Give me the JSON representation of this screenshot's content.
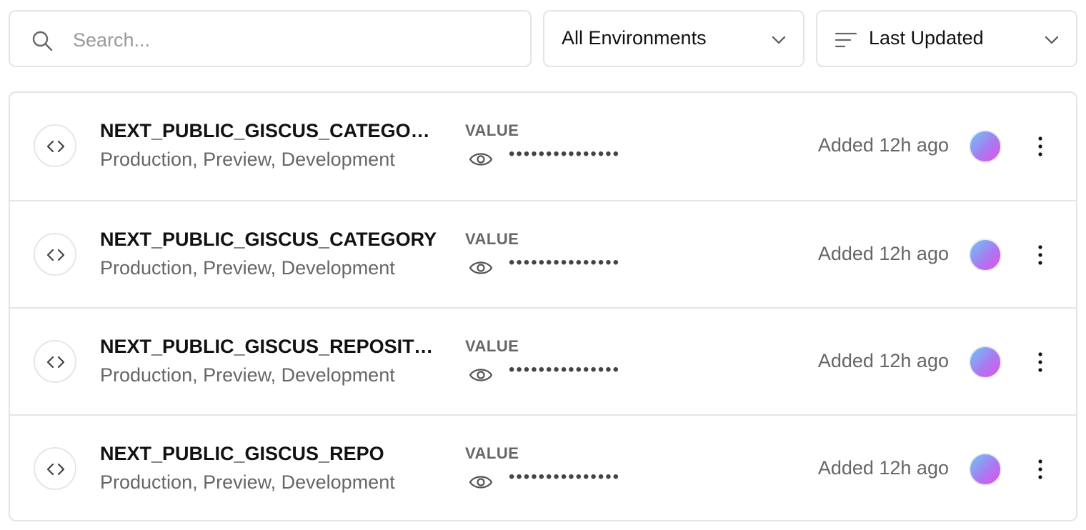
{
  "toolbar": {
    "search": {
      "placeholder": "Search...",
      "value": "",
      "icon": "search-icon"
    },
    "environment_filter": {
      "selected": "All Environments",
      "icon": "chevron-down-icon"
    },
    "sort": {
      "selected": "Last Updated",
      "icon": "sort-lines-icon"
    }
  },
  "variables": [
    {
      "name": "NEXT_PUBLIC_GISCUS_CATEGORY_ID",
      "environments": "Production, Preview, Development",
      "value_label": "VALUE",
      "masked_value": "•••••••••••••••",
      "updated": "Added 12h ago"
    },
    {
      "name": "NEXT_PUBLIC_GISCUS_CATEGORY",
      "environments": "Production, Preview, Development",
      "value_label": "VALUE",
      "masked_value": "•••••••••••••••",
      "updated": "Added 12h ago"
    },
    {
      "name": "NEXT_PUBLIC_GISCUS_REPOSITORY_ID",
      "environments": "Production, Preview, Development",
      "value_label": "VALUE",
      "masked_value": "•••••••••••••••",
      "updated": "Added 12h ago"
    },
    {
      "name": "NEXT_PUBLIC_GISCUS_REPO",
      "environments": "Production, Preview, Development",
      "value_label": "VALUE",
      "masked_value": "•••••••••••••••",
      "updated": "Added 12h ago"
    }
  ],
  "colors": {
    "border": "#e4e4e4",
    "muted_text": "#666666",
    "avatar_gradient": [
      "#6cc7f7",
      "#a97af0",
      "#e350e8"
    ]
  }
}
